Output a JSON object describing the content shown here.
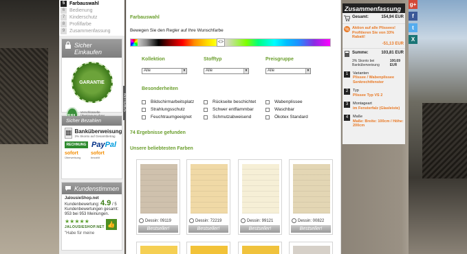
{
  "steps": [
    {
      "num": "5",
      "label": "Farbauswahl",
      "active": true
    },
    {
      "num": "6",
      "label": "Bedienung"
    },
    {
      "num": "7",
      "label": "Kinderschutz"
    },
    {
      "num": "8",
      "label": "Profilfarbe"
    },
    {
      "num": "9",
      "label": "Zusammenfassung"
    }
  ],
  "left": {
    "sicher_einkaufen": "Sicher Einkaufen",
    "seal_text": "GARANTIE",
    "ssl_badge": "SSL",
    "ssl_text": "Verschlüsselte Übertragung Ihrer Kundendaten",
    "scroll_label": "SCROLLEN",
    "sicher_bezahlen": "Sicher Bezahlen",
    "bank_title": "Banküberweisung",
    "bank_sub": "3% Skonto auf Gesamtbetrag",
    "rechnung": "RECHNUNG",
    "paypal_a": "Pay",
    "paypal_b": "Pal",
    "sofort_1": "sofort",
    "sofort_1_sub": "Überweisung",
    "sofort_2": "sofort",
    "sofort_2_sub": "bezahlt",
    "kundenstimmen": "Kundenstimmen",
    "shop": "JalousieShop.net",
    "bewertung_label": "Kundenbewertung:",
    "score": "4.9",
    "score_max": "/ 5",
    "bewertungen": "Kundenbewertungen gesamt: 953 bei 953 Meinungen.",
    "logo_text": "JALOUSIESHOP.NET",
    "quote": "\"Habe für meine"
  },
  "main": {
    "farbauswahl": "Farbauswahl",
    "hint": "Bewegen Sie den Regler auf Ihre Wunschfarbe",
    "handle": "<>",
    "filters": [
      {
        "label": "Kollektion",
        "value": "Alle"
      },
      {
        "label": "Stofftyp",
        "value": "Alle"
      },
      {
        "label": "Preisgruppe",
        "value": "Alle"
      }
    ],
    "besonderheiten": "Besonderheiten",
    "checks": [
      "Bildschirmarbeitsplatz",
      "Rückseite beschichtet",
      "Wabenplissee",
      "Strahlungsschutz",
      "Schwer entflammbar",
      "Waschbar",
      "Feuchtraumgeeignet",
      "Schmutzabweisend",
      "Ökotex Standard"
    ],
    "results": "74 Ergebnisse gefunden",
    "favorites": "Unsere beliebtesten Farben",
    "tiles": [
      {
        "dessin": "Dessin: 09119",
        "badge": "Bestseller!",
        "color": "#cfc1ad"
      },
      {
        "dessin": "Dessin: 72219",
        "badge": "Bestseller!",
        "color": "#f0d9a6"
      },
      {
        "dessin": "Dessin: 99121",
        "badge": "Bestseller!",
        "color": "#f6efd6"
      },
      {
        "dessin": "Dessin: 00822",
        "badge": "Bestseller!",
        "color": "#e3d6b4"
      }
    ],
    "tiles_row2": [
      "#f5cf53",
      "#f2c238",
      "#f0c23c",
      "#d6d0c8"
    ]
  },
  "summary": {
    "title": "Zusammenfassung",
    "gesamt_label": "Gesamt:",
    "gesamt_value": "154,94 EUR",
    "aktion_text": "Aktion auf alle Plissees! Profitieren Sie von 33% Rabatt!",
    "aktion_value": "-51,13 EUR",
    "summe_label": "Summe:",
    "summe_value": "103,81 EUR",
    "skonto_label": "3% Skonto bei Banküberweisung",
    "skonto_value": "100,69 EUR",
    "items": [
      {
        "n": "1",
        "key": "Varianten",
        "val": "Plissee / Wabenplissee Senkrechtfenster"
      },
      {
        "n": "2",
        "key": "Typ",
        "val": "Plissee Typ VS 2"
      },
      {
        "n": "3",
        "key": "Montageart",
        "val": "im Fensterfalz (Glasleiste)"
      },
      {
        "n": "4",
        "key": "Maße",
        "val": "Maße: Breite: 100cm / Höhe: 200cm"
      }
    ]
  },
  "social": [
    {
      "icon": "google-plus-icon",
      "glyph": "g+",
      "color": "#d34836"
    },
    {
      "icon": "facebook-icon",
      "glyph": "f",
      "color": "#3b5998"
    },
    {
      "icon": "twitter-icon",
      "glyph": "t",
      "color": "#55acee"
    },
    {
      "icon": "xing-icon",
      "glyph": "X",
      "color": "#1a7576"
    }
  ]
}
